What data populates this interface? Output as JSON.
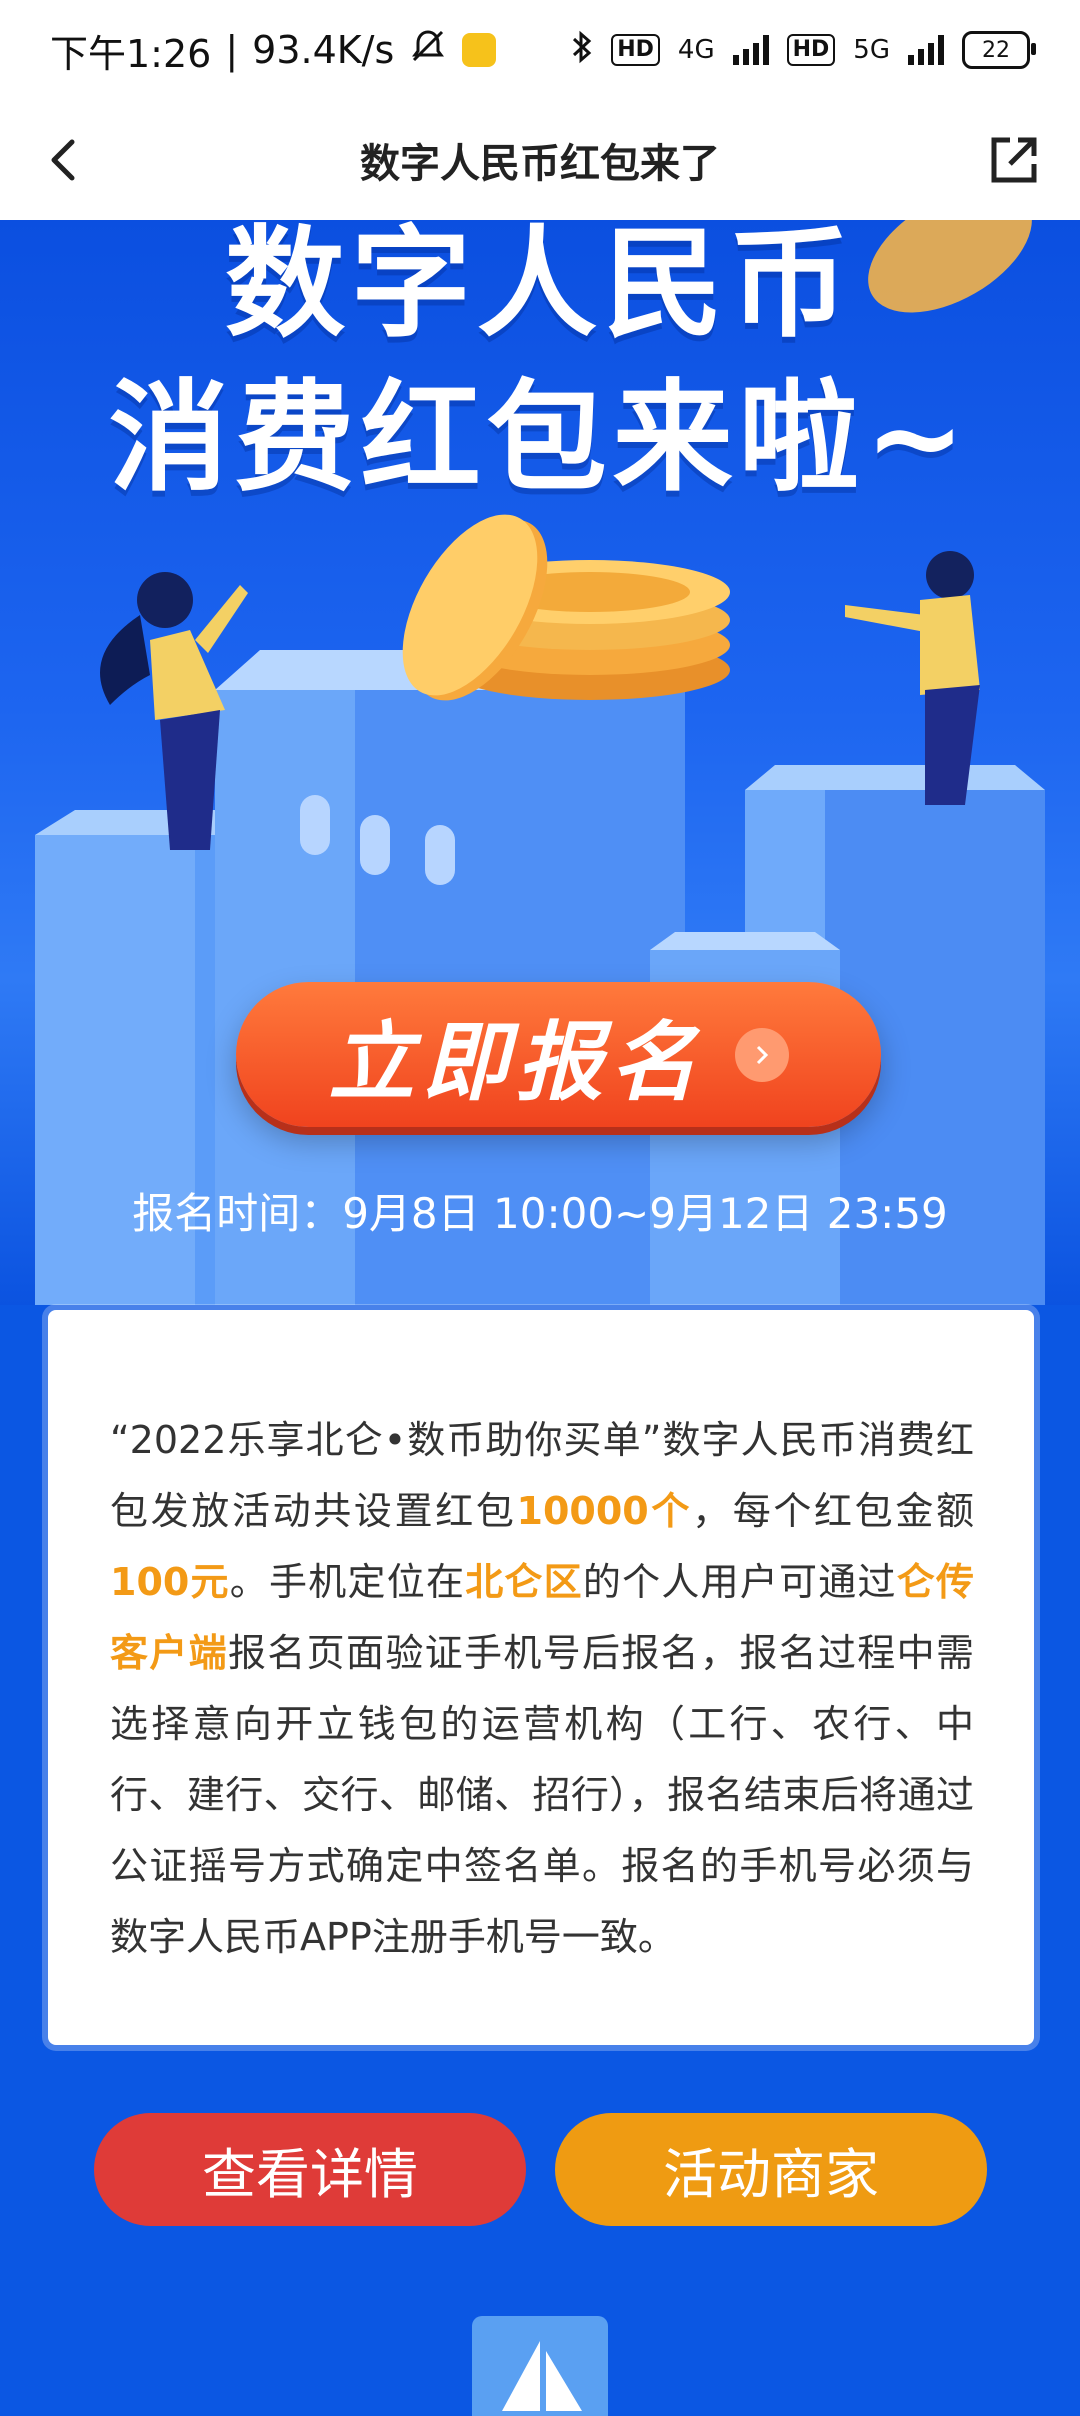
{
  "status_bar": {
    "time": "下午1:26",
    "speed": "93.4K/s",
    "net1": "4G",
    "net2": "5G",
    "battery": "22"
  },
  "nav": {
    "title": "数字人民币红包来了",
    "back_icon": "chevron-left-icon",
    "share_icon": "share-icon"
  },
  "banner": {
    "headline_line1": "数字人民币",
    "headline_line2": "消费红包来啦~",
    "register_button": "立即报名",
    "register_time": "报名时间：9月8日 10:00~9月12日 23:59"
  },
  "description": {
    "seg1": "“2022乐享北仑•数币助你买单”数字人民币消费红包发放活动共设置红包",
    "hl1": "10000个",
    "seg2": "，每个红包金额",
    "hl2": "100元",
    "seg3": "。手机定位在",
    "hl3": "北仑区",
    "seg4": "的个人用户可通过",
    "hl4": "仑传客户端",
    "seg5": "报名页面验证手机号后报名，报名过程中需选择意向开立钱包的运营机构（工行、农行、中行、建行、交行、邮储、招行），报名结束后将通过公证摇号方式确定中签名单。报名的手机号必须与数字人民币APP注册手机号一致。"
  },
  "buttons": {
    "details": "查看详情",
    "merchants": "活动商家"
  },
  "colors": {
    "background": "#0b57e3",
    "highlight": "#f39a16",
    "details_button": "#df3b38",
    "merchants_button": "#ef9b12"
  }
}
